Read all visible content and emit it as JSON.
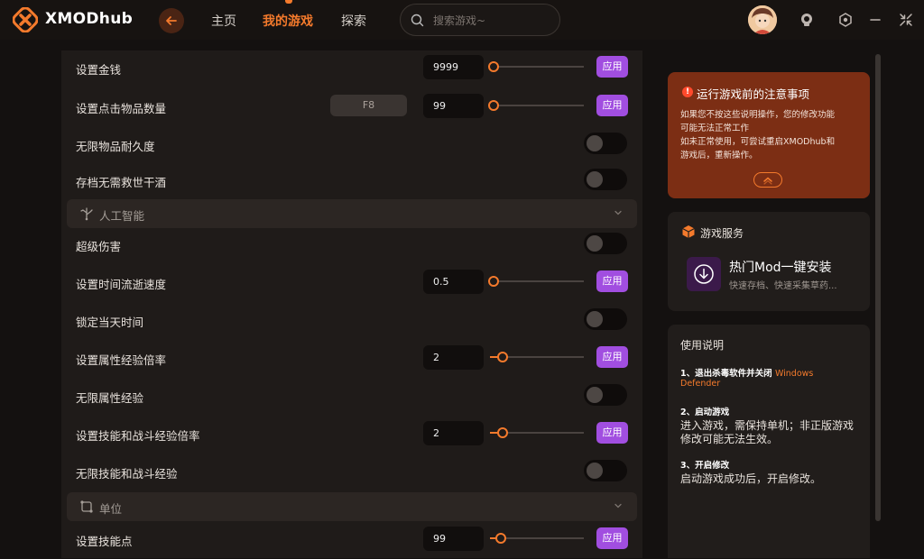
{
  "header": {
    "brand": "XMODhub",
    "nav": [
      "主页",
      "我的游戏",
      "探索"
    ],
    "active_nav": 1,
    "search_placeholder": "搜索游戏~"
  },
  "colors": {
    "accent": "#f47a2c",
    "apply": "#a14ee0",
    "notice_bg": "#7c2e14"
  },
  "rows": [
    {
      "label": "设置金钱",
      "type": "number",
      "value": "9999",
      "slider_fraction": 0.0,
      "button": "应用"
    },
    {
      "label": "设置点击物品数量",
      "type": "number",
      "hotkey": "F8",
      "value": "99",
      "slider_fraction": 0.0,
      "button": "应用"
    },
    {
      "label": "无限物品耐久度",
      "type": "toggle",
      "on": false
    },
    {
      "label": "存档无需救世干酒",
      "type": "toggle",
      "on": false
    },
    {
      "section": "人工智能",
      "icon": "tree-icon"
    },
    {
      "label": "超级伤害",
      "type": "toggle",
      "on": false
    },
    {
      "label": "设置时间流逝速度",
      "type": "number",
      "value": "0.5",
      "slider_fraction": 0.0,
      "button": "应用"
    },
    {
      "label": "锁定当天时间",
      "type": "toggle",
      "on": false
    },
    {
      "label": "设置属性经验倍率",
      "type": "number",
      "value": "2",
      "slider_fraction": 0.1,
      "button": "应用"
    },
    {
      "label": "无限属性经验",
      "type": "toggle",
      "on": false
    },
    {
      "label": "设置技能和战斗经验倍率",
      "type": "number",
      "value": "2",
      "slider_fraction": 0.1,
      "button": "应用"
    },
    {
      "label": "无限技能和战斗经验",
      "type": "toggle",
      "on": false
    },
    {
      "section": "单位",
      "icon": "unit-icon"
    },
    {
      "label": "设置技能点",
      "type": "number",
      "value": "99",
      "slider_fraction": 0.08,
      "button": "应用"
    }
  ],
  "notice": {
    "title": "运行游戏前的注意事项",
    "lines": [
      "如果您不按这些说明操作，您的修改功能",
      "可能无法正常工作",
      "如未正常使用，可尝试重启XMODhub和",
      "游戏后，重新操作。"
    ]
  },
  "service": {
    "title": "游戏服务",
    "name": "热门Mod一键安装",
    "desc": "快速存档、快速采集草药..."
  },
  "usage": {
    "title": "使用说明",
    "steps": [
      {
        "head": "1、退出杀毒软件并关闭",
        "head_highlight": "Windows",
        "body_highlight": "Defender",
        "body": ""
      },
      {
        "head": "2、启动游戏",
        "body": "进入游戏，需保持单机；非正版游戏修改可能无法生效。"
      },
      {
        "head": "3、开启修改",
        "body": "启动游戏成功后，开启修改。"
      }
    ]
  }
}
